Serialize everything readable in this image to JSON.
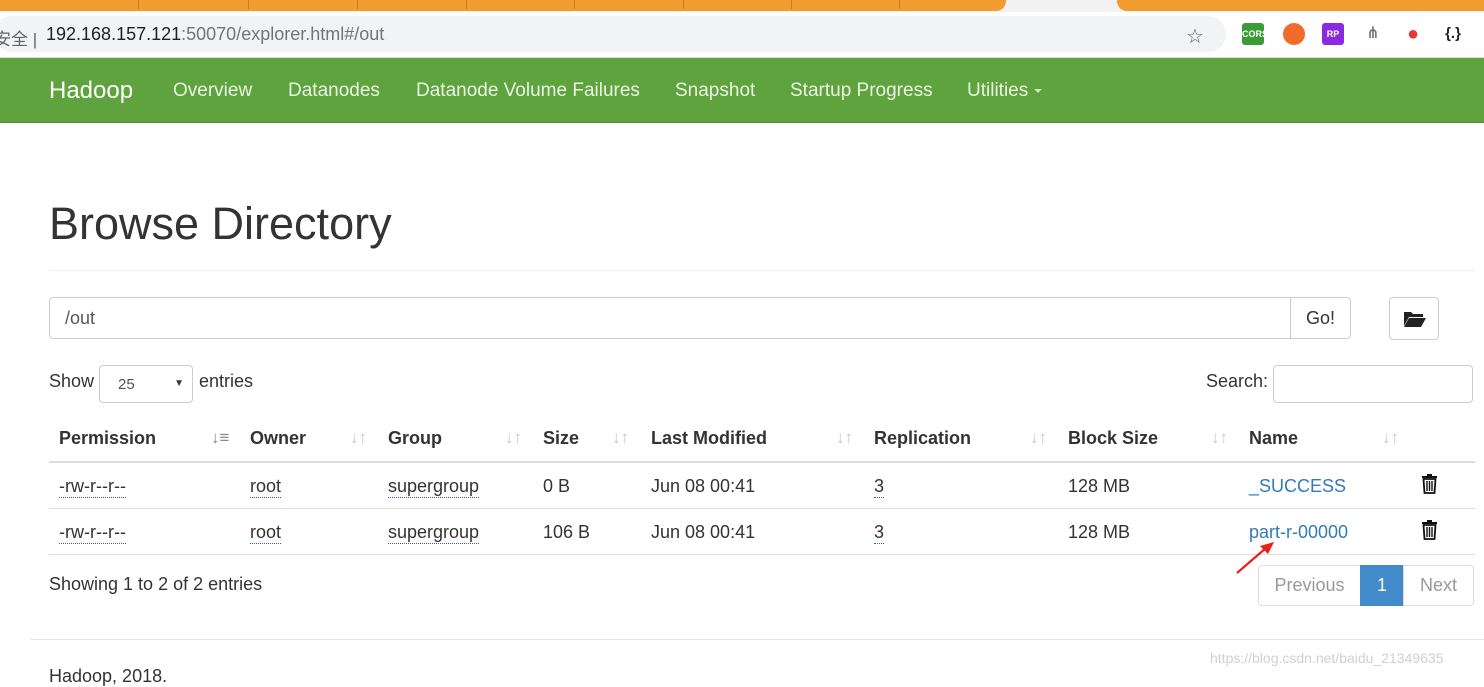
{
  "browser": {
    "secure_label": "安全 |",
    "url_host": "192.168.157.121",
    "url_rest": ":50070/explorer.html#/out",
    "extensions": [
      {
        "name": "cors-extension-icon",
        "label": "CORS",
        "color": "#3d9b35"
      },
      {
        "name": "lifebuoy-extension-icon",
        "label": "",
        "color": "#f06a2a"
      },
      {
        "name": "rp-extension-icon",
        "label": "RP",
        "color": "#8a2be2"
      },
      {
        "name": "sitemap-extension-icon",
        "label": "",
        "color": "#777777"
      },
      {
        "name": "location-extension-icon",
        "label": "",
        "color": "#e53935"
      },
      {
        "name": "json-extension-icon",
        "label": "{.}",
        "color": "#222222"
      }
    ]
  },
  "navbar": {
    "brand": "Hadoop",
    "links": [
      "Overview",
      "Datanodes",
      "Datanode Volume Failures",
      "Snapshot",
      "Startup Progress",
      "Utilities"
    ],
    "color": "#5fa33e"
  },
  "page": {
    "title": "Browse Directory",
    "path_value": "/out",
    "go_label": "Go!",
    "show_label": "Show",
    "entries_value": "25",
    "entries_label": "entries",
    "search_label": "Search:"
  },
  "table": {
    "columns": [
      "Permission",
      "Owner",
      "Group",
      "Size",
      "Last Modified",
      "Replication",
      "Block Size",
      "Name"
    ],
    "rows": [
      {
        "permission": "-rw-r--r--",
        "owner": "root",
        "group": "supergroup",
        "size": "0 B",
        "modified": "Jun 08 00:41",
        "replication": "3",
        "block_size": "128 MB",
        "name": "_SUCCESS"
      },
      {
        "permission": "-rw-r--r--",
        "owner": "root",
        "group": "supergroup",
        "size": "106 B",
        "modified": "Jun 08 00:41",
        "replication": "3",
        "block_size": "128 MB",
        "name": "part-r-00000"
      }
    ]
  },
  "pagination": {
    "info": "Showing 1 to 2 of 2 entries",
    "previous": "Previous",
    "current": "1",
    "next": "Next"
  },
  "footer": {
    "text": "Hadoop, 2018.",
    "watermark": "https://blog.csdn.net/baidu_21349635"
  },
  "colors": {
    "link": "#337ab7",
    "active_page": "#428bca",
    "annotation_arrow": "#e8201b"
  }
}
